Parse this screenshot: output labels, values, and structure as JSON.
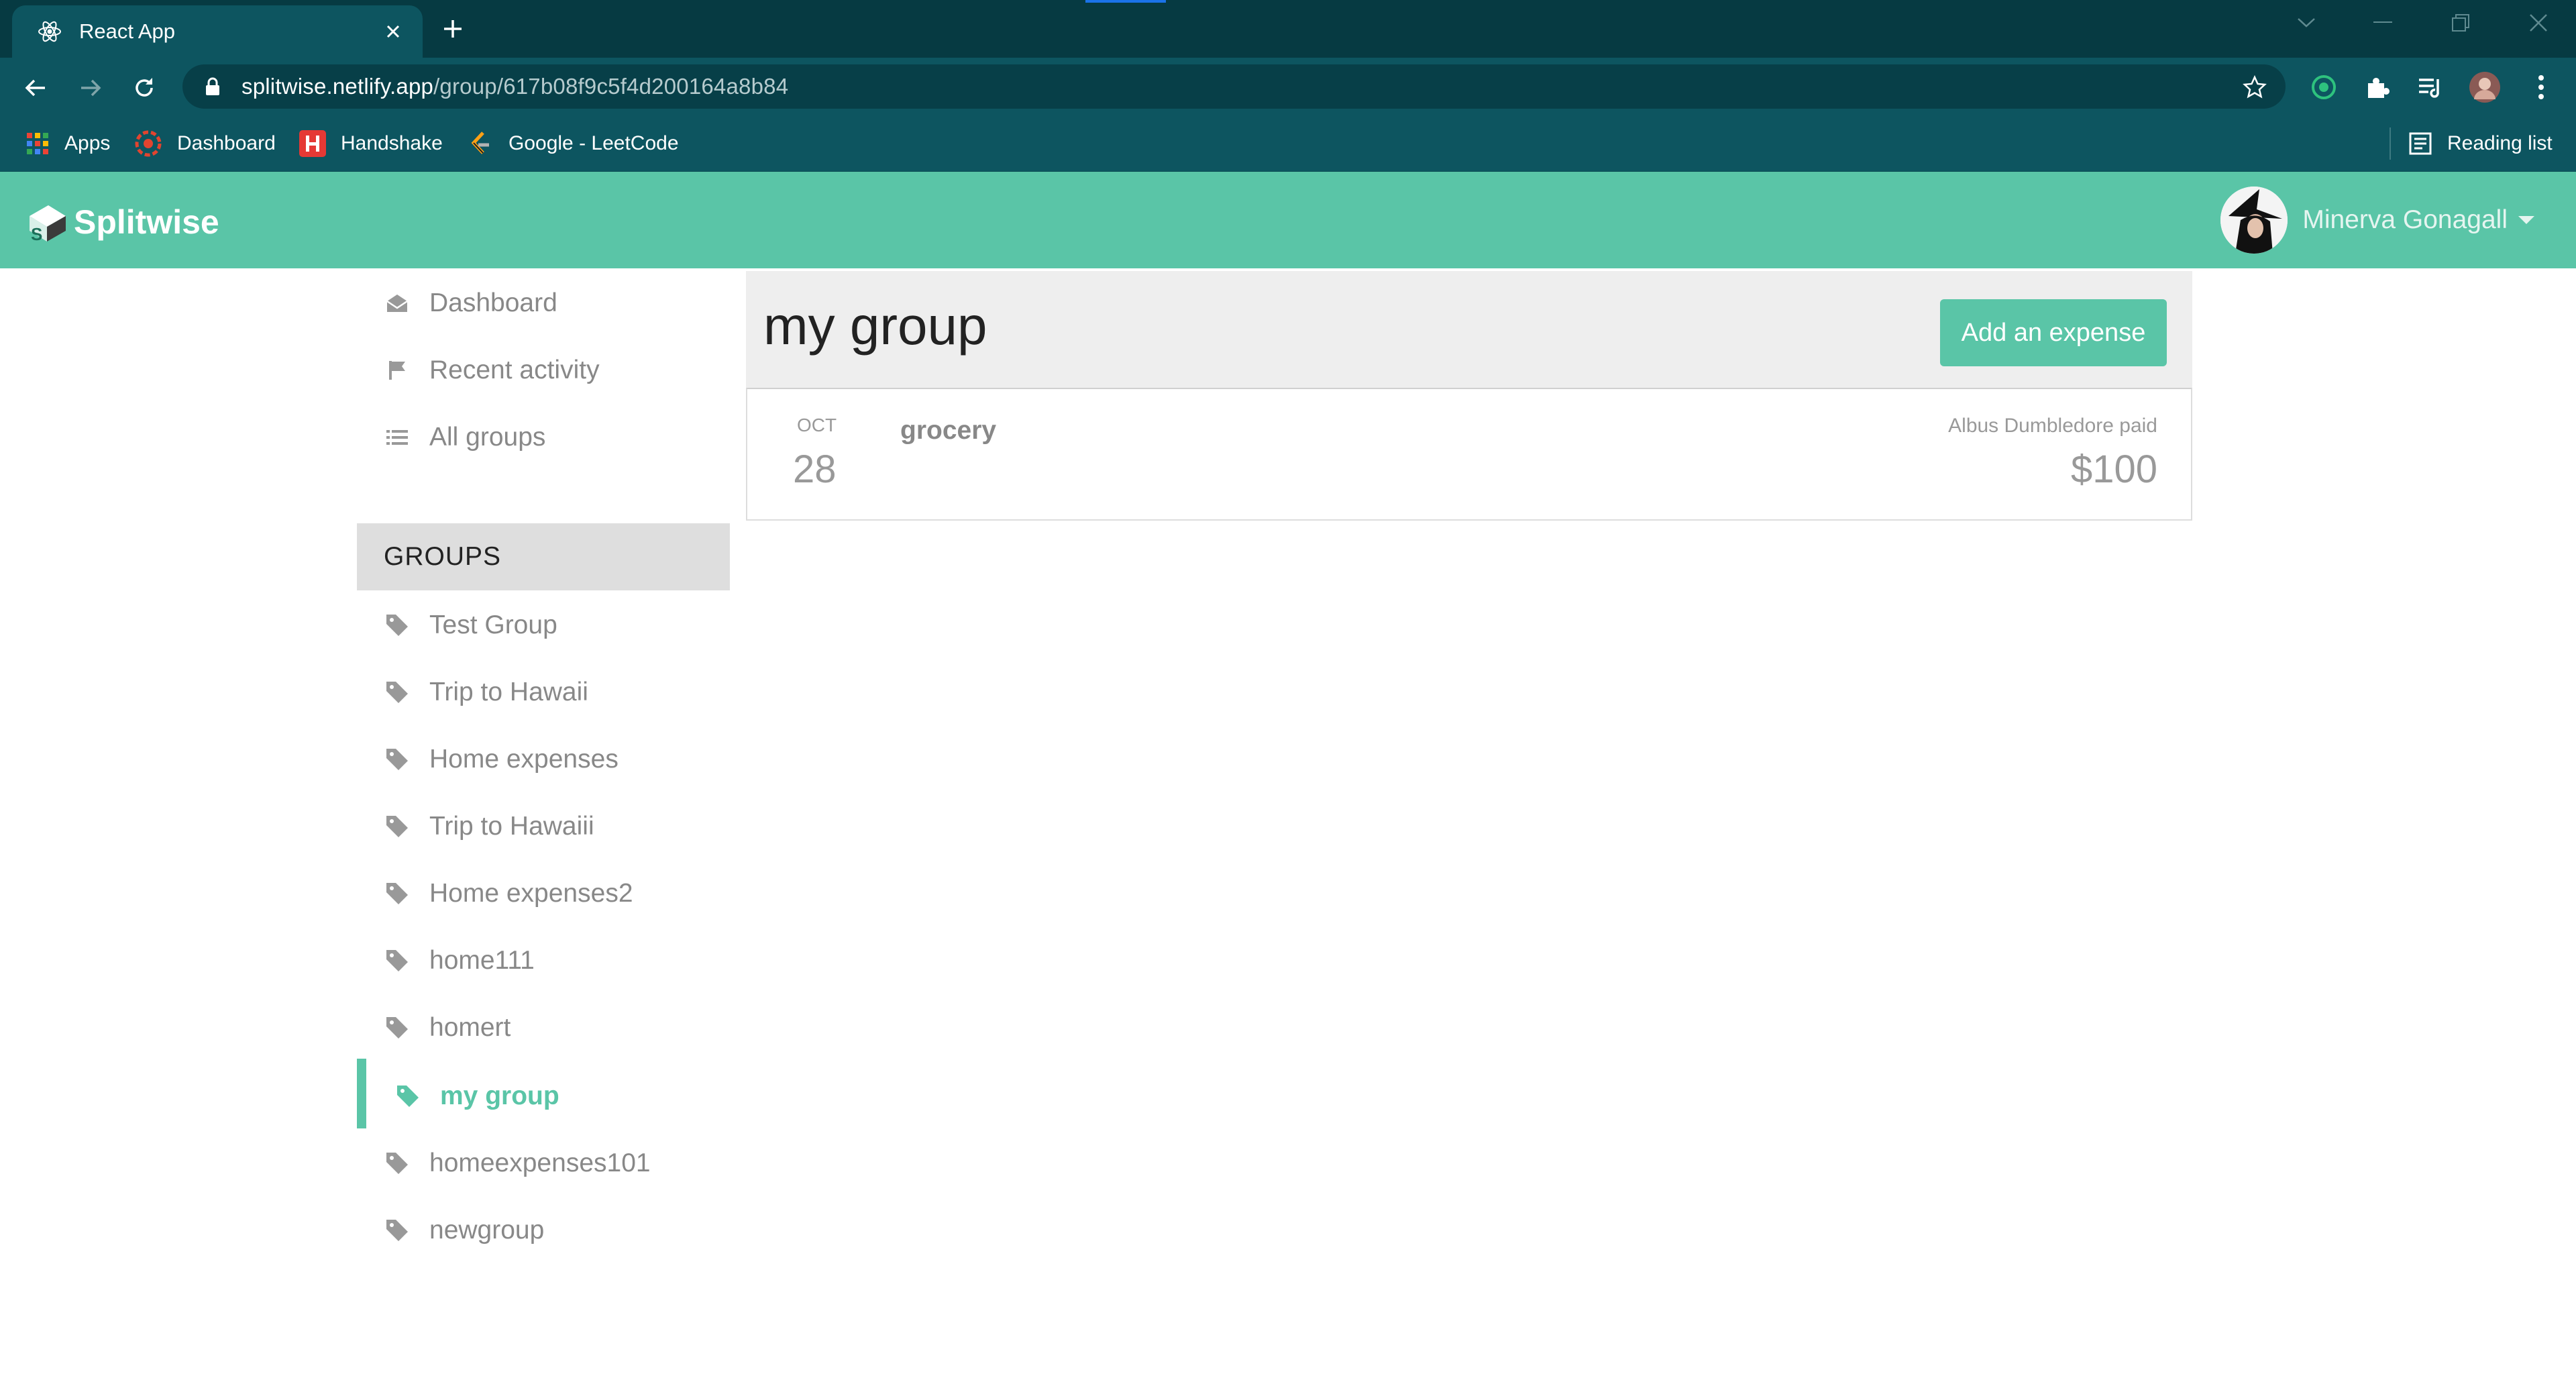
{
  "browser": {
    "tab_title": "React App",
    "url_host": "splitwise.netlify.app",
    "url_path": "/group/617b08f9c5f4d200164a8b84",
    "bookmarks": [
      "Apps",
      "Dashboard",
      "Handshake",
      "Google - LeetCode"
    ],
    "reading_list": "Reading list"
  },
  "header": {
    "brand": "Splitwise",
    "user_name": "Minerva Gonagall"
  },
  "sidebar": {
    "links": [
      {
        "label": "Dashboard",
        "icon": "mail-icon"
      },
      {
        "label": "Recent activity",
        "icon": "flag-icon"
      },
      {
        "label": "All groups",
        "icon": "list-icon"
      }
    ],
    "groups_heading": "GROUPS",
    "groups": [
      "Test Group",
      "Trip to Hawaii",
      "Home expenses",
      "Trip to Hawaiii",
      "Home expenses2",
      "home111",
      "homert",
      "my group",
      "homeexpenses101",
      "newgroup"
    ],
    "active_group_index": 7
  },
  "main": {
    "group_title": "my group",
    "add_expense_label": "Add an expense",
    "expenses": [
      {
        "month": "OCT",
        "day": "28",
        "description": "grocery",
        "payer_text": "Albus Dumbledore paid",
        "amount": "$100"
      }
    ]
  },
  "colors": {
    "brand": "#5ac5a7",
    "chrome_dark": "#063a42",
    "chrome": "#0d5560"
  }
}
